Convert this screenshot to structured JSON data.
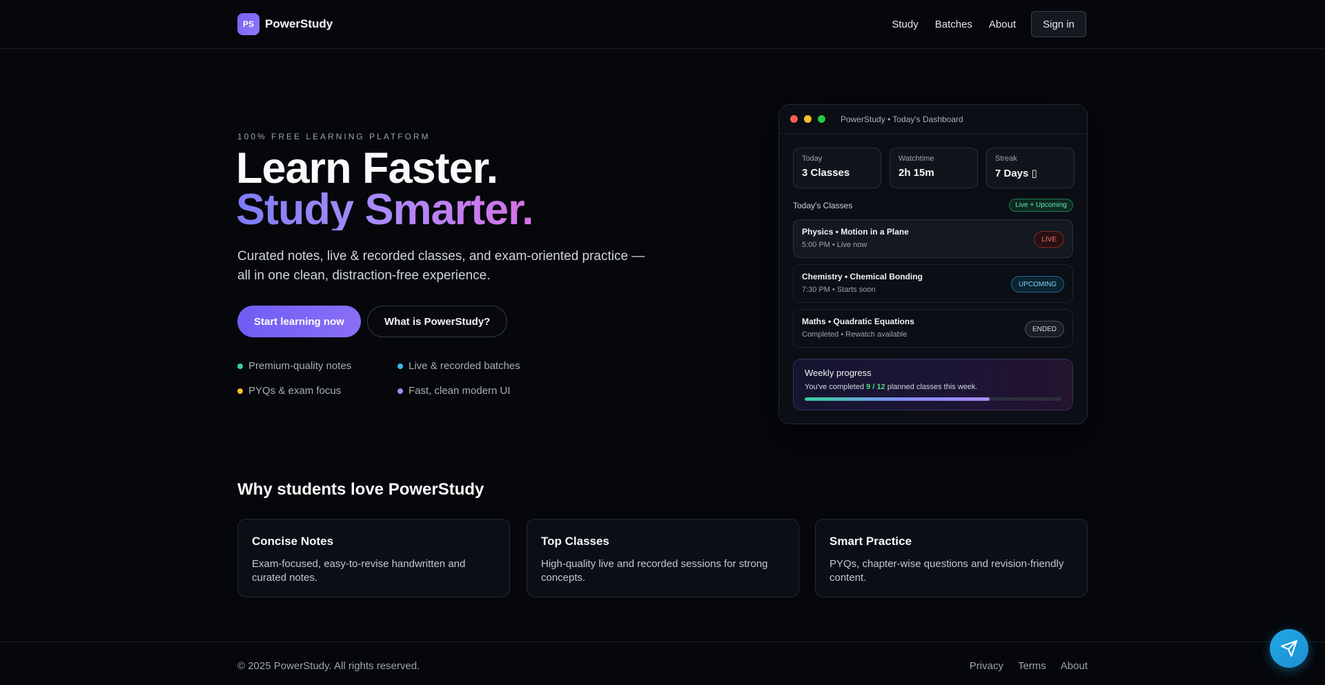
{
  "header": {
    "logo_text": "PS",
    "brand": "PowerStudy",
    "nav": [
      "Study",
      "Batches",
      "About"
    ],
    "signin": "Sign in"
  },
  "hero": {
    "eyebrow": "100% FREE LEARNING PLATFORM",
    "title_line1": "Learn Faster.",
    "title_line2": "Study Smarter.",
    "subtitle": "Curated notes, live & recorded classes, and exam-oriented practice — all in one clean, distraction-free experience.",
    "cta_primary": "Start learning now",
    "cta_secondary": "What is PowerStudy?",
    "features": [
      {
        "label": "Premium-quality notes",
        "color": "#34d399"
      },
      {
        "label": "Live & recorded batches",
        "color": "#38bdf8"
      },
      {
        "label": "PYQs & exam focus",
        "color": "#fbbf24"
      },
      {
        "label": "Fast, clean modern UI",
        "color": "#a78bfa"
      }
    ]
  },
  "dashboard": {
    "window_title": "PowerStudy • Today's Dashboard",
    "stats": [
      {
        "label": "Today",
        "value": "3 Classes"
      },
      {
        "label": "Watchtime",
        "value": "2h 15m"
      },
      {
        "label": "Streak",
        "value": "7 Days ▯"
      }
    ],
    "section_label": "Today's Classes",
    "section_badge": "Live + Upcoming",
    "classes": [
      {
        "name": "Physics • Motion in a Plane",
        "meta": "5:00 PM • Live now",
        "status": "LIVE"
      },
      {
        "name": "Chemistry • Chemical Bonding",
        "meta": "7:30 PM • Starts soon",
        "status": "UPCOMING"
      },
      {
        "name": "Maths • Quadratic Equations",
        "meta": "Completed • Rewatch available",
        "status": "ENDED"
      }
    ],
    "weekly": {
      "title": "Weekly progress",
      "text_before": "You've completed ",
      "highlight": "9 / 12",
      "text_after": " planned classes this week.",
      "progress": 0.72
    }
  },
  "why": {
    "title": "Why students love PowerStudy",
    "cards": [
      {
        "title": "Concise Notes",
        "text": "Exam-focused, easy-to-revise handwritten and curated notes."
      },
      {
        "title": "Top Classes",
        "text": "High-quality live and recorded sessions for strong concepts."
      },
      {
        "title": "Smart Practice",
        "text": "PYQs, chapter-wise questions and revision-friendly content."
      }
    ]
  },
  "footer": {
    "copyright": "© 2025 PowerStudy. All rights reserved.",
    "links": [
      "Privacy",
      "Terms",
      "About"
    ]
  },
  "colors": {
    "window_red": "#ff5f57",
    "window_yellow": "#febc2e",
    "window_green": "#28c840",
    "fab": "#22a9e8"
  },
  "icons": {
    "fab": "send-icon"
  }
}
